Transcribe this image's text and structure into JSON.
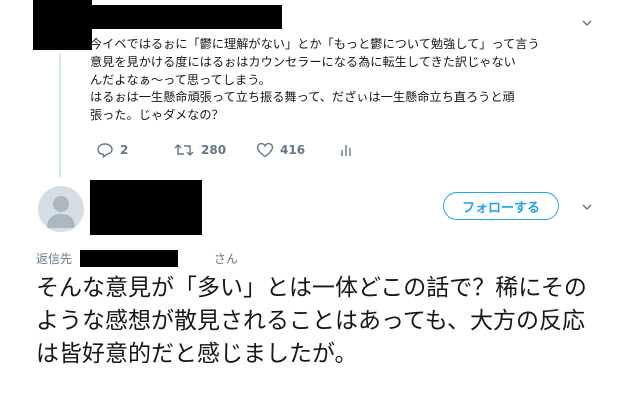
{
  "prev_tweet": {
    "text": "今イベではるぉに「鬱に理解がない」とか「もっと鬱について勉強して」って言う\n意見を見かける度にはるぉはカウンセラーになる為に転生してきた訳じゃない\nんだよなぁ〜って思ってしまう。\nはるぉは一生懸命頑張って立ち振る舞って、だざぃは一生懸命立ち直ろうと頑\n張った。じゃダメなの？",
    "actions": {
      "reply_count": "2",
      "retweet_count": "280",
      "like_count": "416"
    }
  },
  "reply_tweet": {
    "follow_label": "フォローする",
    "reply_to_prefix": "返信先",
    "reply_to_suffix": "さん",
    "text": "そんな意見が「多い」とは一体どこの話で？稀にそのような感想が散見されることはあっても、大方の反応は皆好意的だと感じましたが。"
  },
  "colors": {
    "accent": "#1da1f2",
    "muted": "#657786",
    "thread_line": "#cfe6f7"
  },
  "icons": [
    "reply-icon",
    "retweet-icon",
    "like-icon",
    "analytics-icon",
    "chevron-down-icon",
    "default-avatar-icon"
  ]
}
